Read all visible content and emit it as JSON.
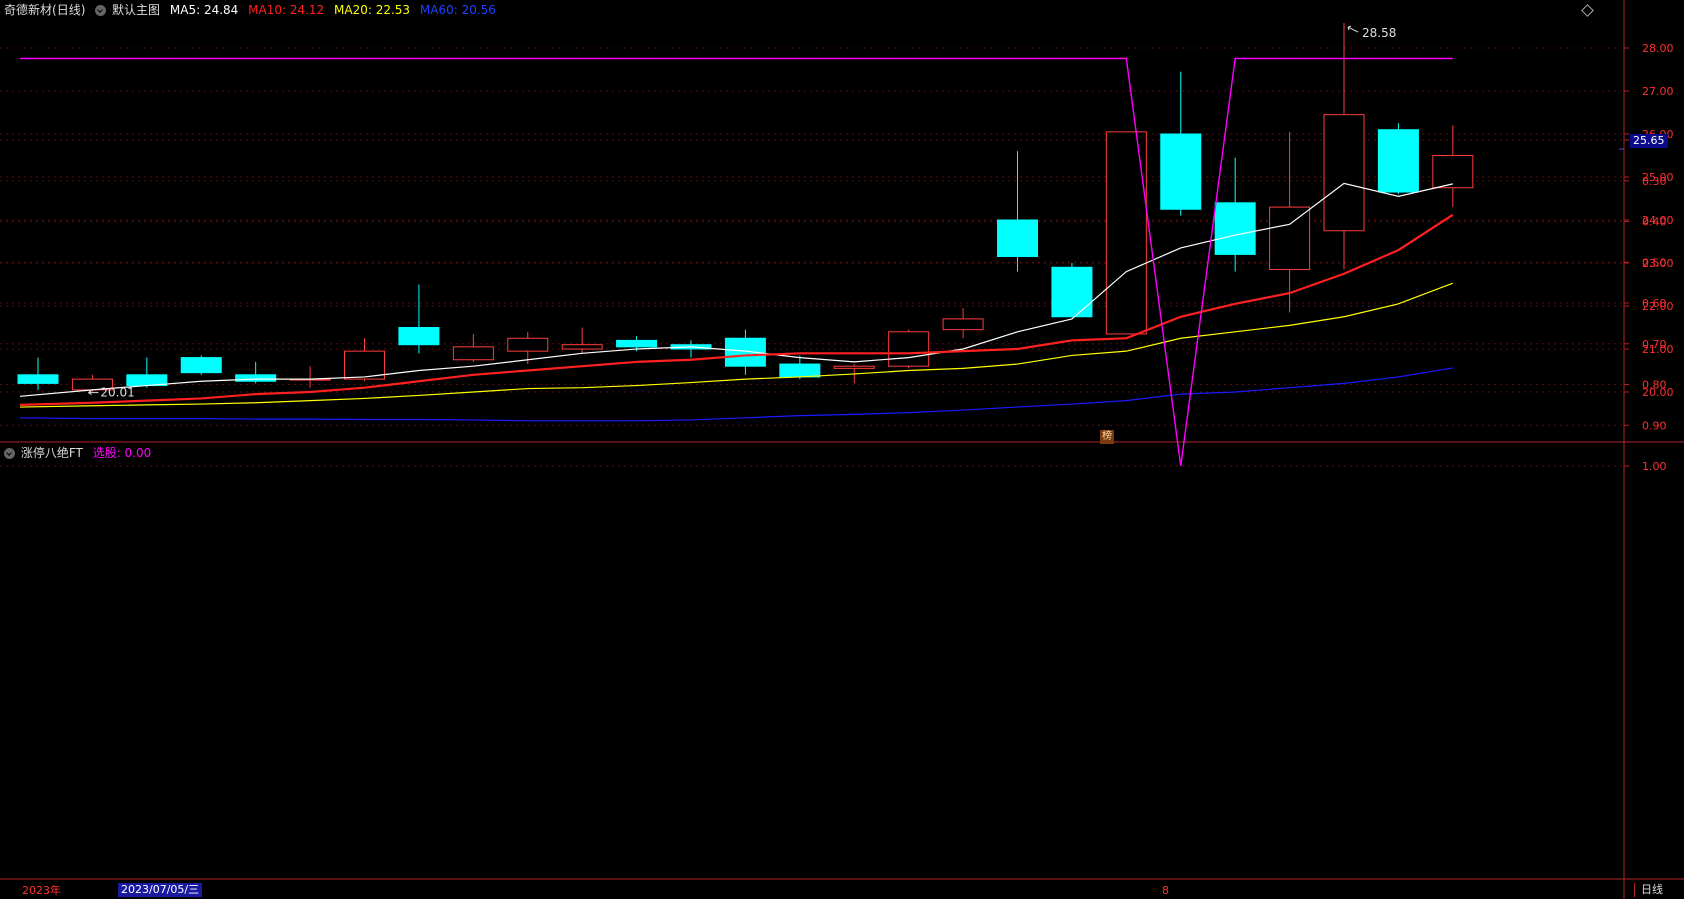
{
  "stock_name": "奇德新材",
  "period_label": "(日线)",
  "main_panel": {
    "template_label": "默认主图",
    "ma_labels": [
      {
        "text": "MA5: 24.84",
        "color": "#ffffff"
      },
      {
        "text": "MA10: 24.12",
        "color": "#ff2020"
      },
      {
        "text": "MA20: 22.53",
        "color": "#ffff00"
      },
      {
        "text": "MA60: 20.56",
        "color": "#2040ff"
      }
    ]
  },
  "sub_panel": {
    "indicator_label": "涨停八绝FT",
    "value_label": "选股: 0.00"
  },
  "current_price": "25.65",
  "high_annotation": "28.58",
  "low_annotation": "20.01",
  "event_marker": "榜",
  "bottom_bar": {
    "year_label": "2023年",
    "date_label": "2023/07/05/三",
    "tick_label": "8",
    "period_button": "日线"
  },
  "colors": {
    "up": "#ff3c3c",
    "down": "#00ffff",
    "axis": "#b22222",
    "signal": "#ff00ff"
  },
  "chart_data": [
    {
      "type": "candlestick",
      "title": "",
      "ylim": [
        19.2,
        28.6
      ],
      "y_ticks": [
        "20.00",
        "21.00",
        "22.00",
        "23.00",
        "24.00",
        "25.00",
        "26.00",
        "27.00",
        "28.00"
      ],
      "candles": [
        {
          "open": 20.4,
          "high": 20.8,
          "low": 20.05,
          "close": 20.2
        },
        {
          "open": 20.05,
          "high": 20.4,
          "low": 20.01,
          "close": 20.3
        },
        {
          "open": 20.4,
          "high": 20.8,
          "low": 20.1,
          "close": 20.15
        },
        {
          "open": 20.8,
          "high": 20.85,
          "low": 20.4,
          "close": 20.45
        },
        {
          "open": 20.4,
          "high": 20.7,
          "low": 20.2,
          "close": 20.25
        },
        {
          "open": 20.3,
          "high": 20.6,
          "low": 20.1,
          "close": 20.3
        },
        {
          "open": 20.3,
          "high": 21.25,
          "low": 20.25,
          "close": 20.95
        },
        {
          "open": 21.5,
          "high": 22.5,
          "low": 20.9,
          "close": 21.1
        },
        {
          "open": 20.75,
          "high": 21.35,
          "low": 20.7,
          "close": 21.05
        },
        {
          "open": 20.95,
          "high": 21.4,
          "low": 20.65,
          "close": 21.25
        },
        {
          "open": 21.0,
          "high": 21.5,
          "low": 20.9,
          "close": 21.1
        },
        {
          "open": 21.2,
          "high": 21.3,
          "low": 20.95,
          "close": 21.05
        },
        {
          "open": 21.1,
          "high": 21.2,
          "low": 20.8,
          "close": 21.0
        },
        {
          "open": 21.25,
          "high": 21.45,
          "low": 20.4,
          "close": 20.6
        },
        {
          "open": 20.65,
          "high": 20.85,
          "low": 20.3,
          "close": 20.35
        },
        {
          "open": 20.55,
          "high": 20.65,
          "low": 20.2,
          "close": 20.6
        },
        {
          "open": 20.6,
          "high": 21.45,
          "low": 20.55,
          "close": 21.4
        },
        {
          "open": 21.45,
          "high": 21.95,
          "low": 21.25,
          "close": 21.7
        },
        {
          "open": 24.0,
          "high": 25.6,
          "low": 22.8,
          "close": 23.15
        },
        {
          "open": 22.9,
          "high": 23.0,
          "low": 21.75,
          "close": 21.75
        },
        {
          "open": 21.35,
          "high": 26.05,
          "low": 21.35,
          "close": 26.05
        },
        {
          "open": 26.0,
          "high": 27.45,
          "low": 24.1,
          "close": 24.25
        },
        {
          "open": 24.4,
          "high": 25.45,
          "low": 22.8,
          "close": 23.2
        },
        {
          "open": 22.85,
          "high": 26.05,
          "low": 21.85,
          "close": 24.3
        },
        {
          "open": 23.75,
          "high": 28.58,
          "low": 22.85,
          "close": 26.45
        },
        {
          "open": 26.1,
          "high": 26.25,
          "low": 24.6,
          "close": 24.65
        },
        {
          "open": 24.75,
          "high": 26.2,
          "low": 24.3,
          "close": 25.5
        }
      ],
      "series": [
        {
          "name": "MA5",
          "values": [
            19.9,
            20.05,
            20.15,
            20.25,
            20.3,
            20.3,
            20.35,
            20.5,
            20.6,
            20.75,
            20.9,
            21.0,
            21.05,
            20.95,
            20.8,
            20.7,
            20.8,
            21.0,
            21.4,
            21.7,
            22.8,
            23.35,
            23.65,
            23.9,
            24.85,
            24.55,
            24.84
          ]
        },
        {
          "name": "MA10",
          "values": [
            19.7,
            19.75,
            19.8,
            19.85,
            19.95,
            20.0,
            20.1,
            20.25,
            20.4,
            20.5,
            20.6,
            20.7,
            20.75,
            20.85,
            20.9,
            20.9,
            20.9,
            20.95,
            21.0,
            21.2,
            21.25,
            21.75,
            22.05,
            22.3,
            22.75,
            23.3,
            24.12
          ]
        },
        {
          "name": "MA20",
          "values": [
            19.65,
            19.68,
            19.7,
            19.72,
            19.75,
            19.8,
            19.85,
            19.92,
            20.0,
            20.08,
            20.1,
            20.15,
            20.22,
            20.3,
            20.35,
            20.42,
            20.5,
            20.55,
            20.65,
            20.85,
            20.95,
            21.25,
            21.4,
            21.55,
            21.75,
            22.05,
            22.53
          ]
        },
        {
          "name": "MA60",
          "values": [
            19.4,
            19.38,
            19.38,
            19.38,
            19.37,
            19.37,
            19.36,
            19.36,
            19.35,
            19.33,
            19.33,
            19.33,
            19.35,
            19.4,
            19.45,
            19.48,
            19.52,
            19.58,
            19.65,
            19.72,
            19.8,
            19.95,
            20.0,
            20.1,
            20.2,
            20.35,
            20.56
          ]
        }
      ]
    },
    {
      "type": "line",
      "title": "",
      "ylim": [
        0,
        1.05
      ],
      "y_ticks": [
        "0.20",
        "0.30",
        "0.40",
        "0.50",
        "0.60",
        "0.70",
        "0.80",
        "0.90",
        "1.00"
      ],
      "series": [
        {
          "name": "选股",
          "values": [
            0,
            0,
            0,
            0,
            0,
            0,
            0,
            0,
            0,
            0,
            0,
            0,
            0,
            0,
            0,
            0,
            0,
            0,
            0,
            0,
            0,
            1,
            0,
            0,
            0,
            0,
            0
          ]
        }
      ]
    }
  ]
}
